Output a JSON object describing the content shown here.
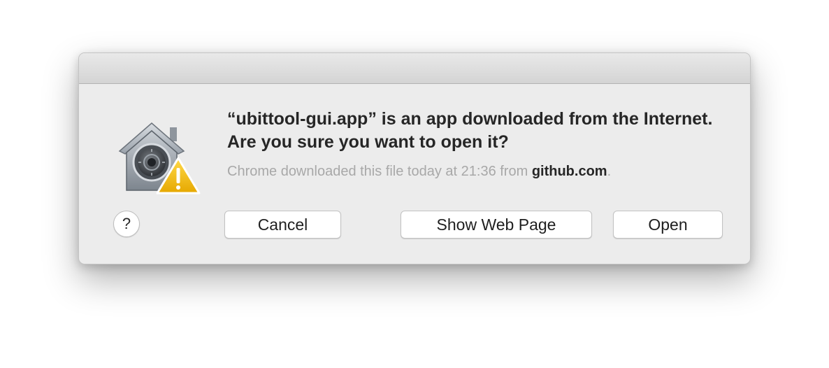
{
  "dialog": {
    "heading": "“ubittool-gui.app” is an app downloaded from the Internet. Are you sure you want to open it?",
    "subtext_prefix": "Chrome downloaded this file today at 21:36 from ",
    "subtext_host": "github.com",
    "subtext_suffix": ".",
    "icon": "gatekeeper-security-icon"
  },
  "buttons": {
    "help": "?",
    "cancel": "Cancel",
    "show_web_page": "Show Web Page",
    "open": "Open"
  }
}
